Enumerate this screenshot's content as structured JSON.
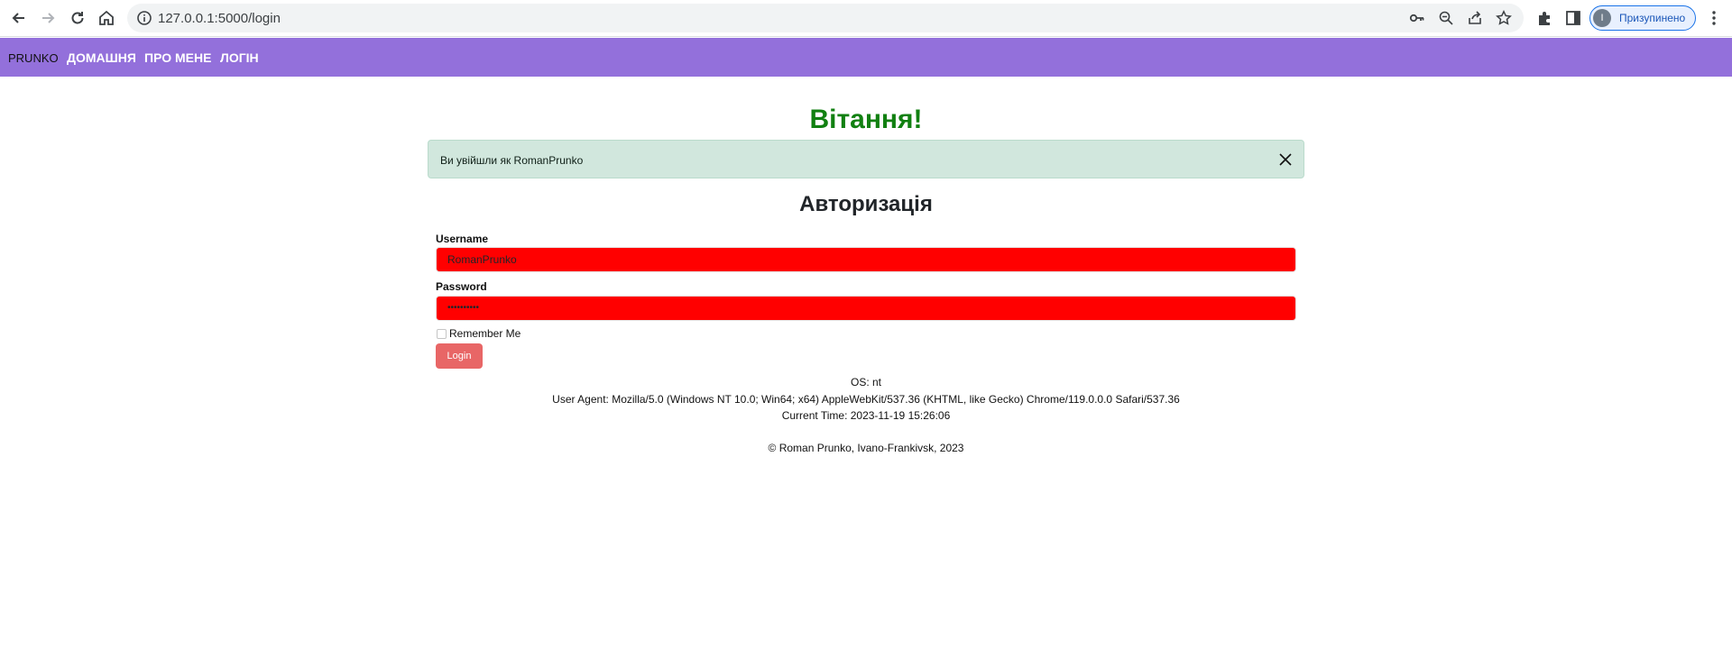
{
  "browser": {
    "url": "127.0.0.1:5000/login",
    "profile_label": "Призупинено",
    "profile_initial": "I"
  },
  "navbar": {
    "brand": "PRUNKO",
    "links": [
      "ДОМАШНЯ",
      "ПРО МЕНЕ",
      "ЛОГІН"
    ],
    "color": "#9370db"
  },
  "page": {
    "greeting": "Вітання!",
    "alert_text": "Ви увійшли як RomanPrunko",
    "form_title": "Авторизація"
  },
  "form": {
    "username_label": "Username",
    "username_value": "RomanPrunko",
    "password_label": "Password",
    "password_value": "••••••••••",
    "remember_label": "Remember Me",
    "login_label": "Login"
  },
  "info": {
    "os": "OS: nt",
    "user_agent": "User Agent: Mozilla/5.0 (Windows NT 10.0; Win64; x64) AppleWebKit/537.36 (KHTML, like Gecko) Chrome/119.0.0.0 Safari/537.36",
    "current_time": "Current Time: 2023-11-19 15:26:06",
    "footer": "© Roman Prunko, Ivano-Frankivsk, 2023"
  },
  "icons": {
    "back": "arrow-left-icon",
    "forward": "arrow-right-icon",
    "reload": "reload-icon",
    "home": "home-icon",
    "info": "info-icon",
    "key": "key-icon",
    "zoom": "zoom-icon",
    "share": "share-icon",
    "star": "star-icon",
    "extensions": "puzzle-icon",
    "sidepanel": "side-panel-icon",
    "menu": "more-vert-icon",
    "close": "close-icon"
  }
}
